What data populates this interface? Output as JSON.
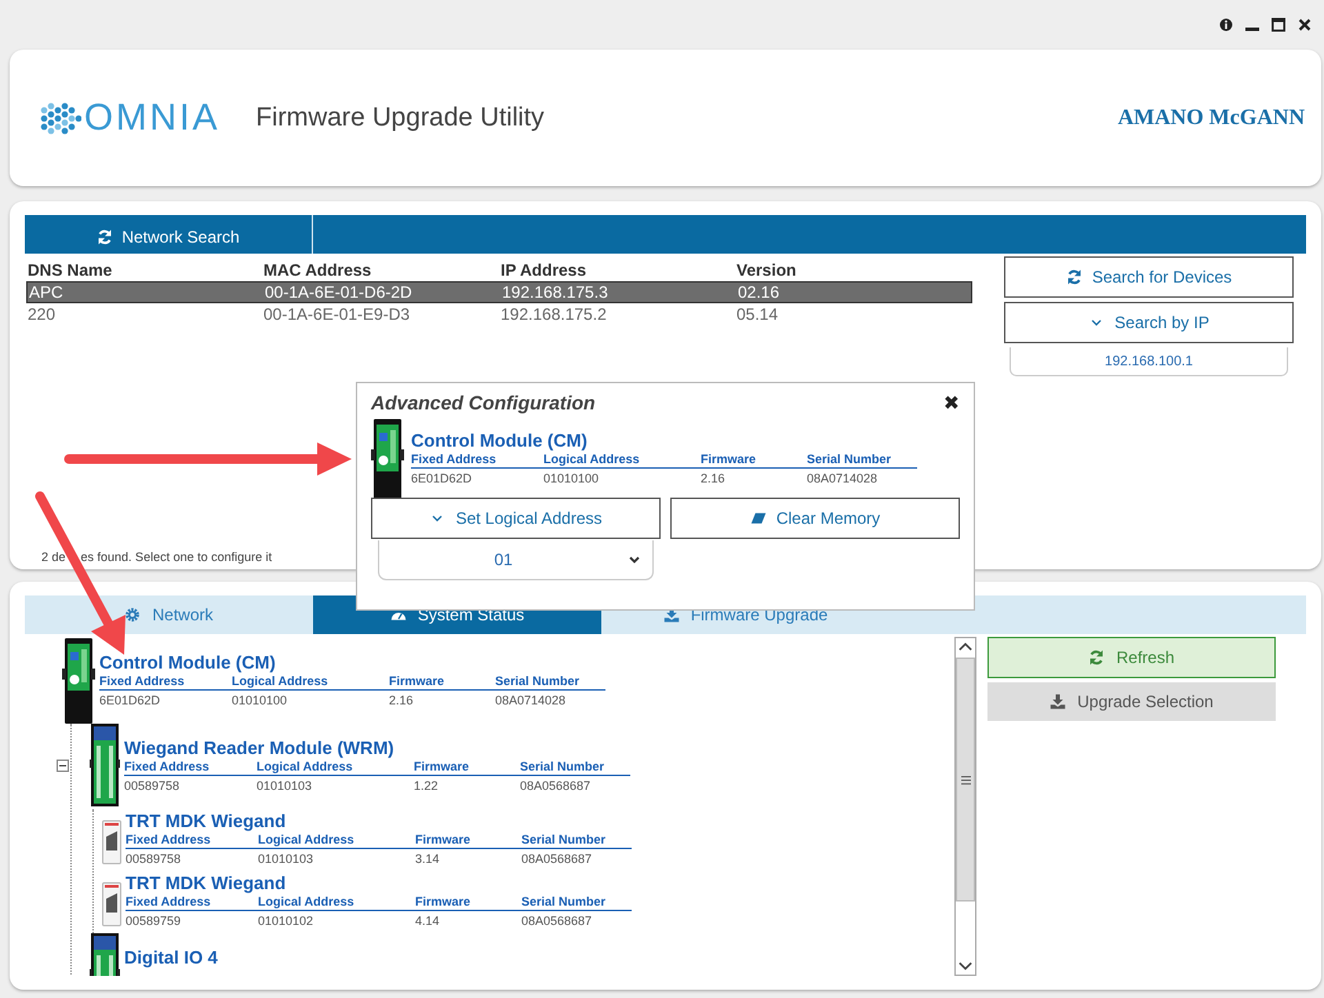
{
  "header": {
    "logo": "OMNIA",
    "title": "Firmware Upgrade Utility",
    "brand": "AMANO McGANN"
  },
  "network": {
    "tab": "Network Search",
    "columns": [
      "DNS Name",
      "MAC Address",
      "IP Address",
      "Version"
    ],
    "rows": [
      {
        "cells": [
          "APC",
          "00-1A-6E-01-D6-2D",
          "192.168.175.3",
          "02.16"
        ],
        "selected": true
      },
      {
        "cells": [
          "220",
          "00-1A-6E-01-E9-D3",
          "192.168.175.2",
          "05.14"
        ],
        "selected": false
      }
    ],
    "buttons": [
      {
        "label": "Search for Devices",
        "kind": "refresh"
      },
      {
        "label": "Search by IP",
        "kind": "expand"
      }
    ],
    "ip_field": {
      "value": "192.168.100.1"
    },
    "status": [
      "2 de",
      "es found. Select one to configure it"
    ]
  },
  "dialog": {
    "title": "Advanced Configuration",
    "close": "✖",
    "module": {
      "name": "Control Module (CM)",
      "kind": "controller",
      "fields": [
        {
          "label": "Fixed Address",
          "value": "6E01D62D"
        },
        {
          "label": "Logical Address",
          "value": "01010100"
        },
        {
          "label": "Firmware",
          "value": "2.16"
        },
        {
          "label": "Serial Number",
          "value": "08A0714028"
        }
      ]
    },
    "buttons": [
      {
        "label": "Set Logical Address",
        "kind": "expand"
      },
      {
        "label": "Clear Memory",
        "kind": "eraser"
      }
    ],
    "address_select": {
      "value": "01"
    }
  },
  "tabs": [
    {
      "label": "Network",
      "selected": false,
      "kind": "gear"
    },
    {
      "label": "System Status",
      "selected": true,
      "kind": "gauge"
    },
    {
      "label": "Firmware Upgrade",
      "selected": false,
      "kind": "download"
    }
  ],
  "tree": [
    {
      "name": "Control Module (CM)",
      "kind": "controller",
      "fields": [
        {
          "label": "Fixed Address",
          "value": "6E01D62D"
        },
        {
          "label": "Logical Address",
          "value": "01010100"
        },
        {
          "label": "Firmware",
          "value": "2.16"
        },
        {
          "label": "Serial Number",
          "value": "08A0714028"
        }
      ],
      "children": [
        {
          "name": "Wiegand Reader Module (WRM)",
          "kind": "io_module",
          "expanded": true,
          "fields": [
            {
              "label": "Fixed Address",
              "value": "00589758"
            },
            {
              "label": "Logical Address",
              "value": "01010103"
            },
            {
              "label": "Firmware",
              "value": "1.22"
            },
            {
              "label": "Serial Number",
              "value": "08A0568687"
            }
          ],
          "children": [
            {
              "name": "TRT MDK Wiegand",
              "kind": "reader",
              "fields": [
                {
                  "label": "Fixed Address",
                  "value": "00589758"
                },
                {
                  "label": "Logical Address",
                  "value": "01010103"
                },
                {
                  "label": "Firmware",
                  "value": "3.14"
                },
                {
                  "label": "Serial Number",
                  "value": "08A0568687"
                }
              ]
            },
            {
              "name": "TRT MDK Wiegand",
              "kind": "reader",
              "fields": [
                {
                  "label": "Fixed Address",
                  "value": "00589759"
                },
                {
                  "label": "Logical Address",
                  "value": "01010102"
                },
                {
                  "label": "Firmware",
                  "value": "4.14"
                },
                {
                  "label": "Serial Number",
                  "value": "08A0568687"
                }
              ]
            }
          ]
        },
        {
          "name": "Digital IO 4",
          "kind": "io_module"
        }
      ]
    }
  ],
  "actions": [
    {
      "label": "Refresh",
      "kind": "refresh"
    },
    {
      "label": "Upgrade Selection",
      "kind": "download"
    }
  ]
}
